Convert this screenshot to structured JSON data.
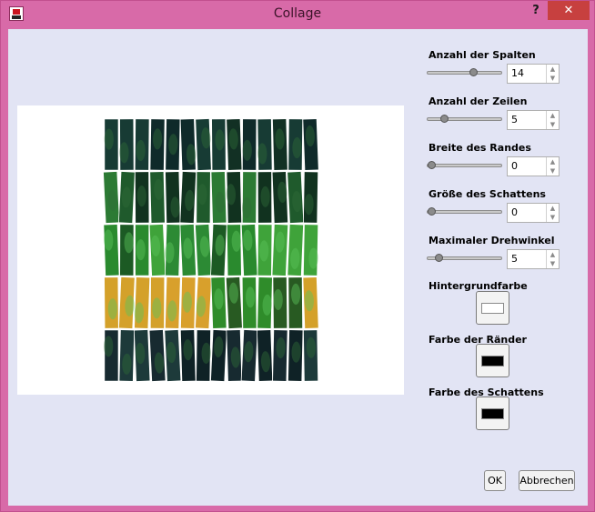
{
  "window": {
    "title": "Collage",
    "help_label": "?",
    "close_label": "✕"
  },
  "controls": {
    "columns": {
      "label": "Anzahl der Spalten",
      "value": "14",
      "slider_fraction": 0.62
    },
    "rows": {
      "label": "Anzahl der Zeilen",
      "value": "5",
      "slider_fraction": 0.19
    },
    "border_width": {
      "label": "Breite des Randes",
      "value": "0",
      "slider_fraction": 0.0
    },
    "shadow_size": {
      "label": "Größe des Schattens",
      "value": "0",
      "slider_fraction": 0.0
    },
    "max_rotation": {
      "label": "Maximaler Drehwinkel",
      "value": "5",
      "slider_fraction": 0.11
    }
  },
  "colors": {
    "background": {
      "label": "Hintergrundfarbe",
      "swatch": "#ffffff"
    },
    "border": {
      "label": "Farbe der Ränder",
      "swatch": "#000000"
    },
    "shadow": {
      "label": "Farbe des Schattens",
      "swatch": "#000000"
    }
  },
  "buttons": {
    "ok": "OK",
    "cancel": "Abbrechen"
  },
  "preview": {
    "grid_columns": 14,
    "grid_rows": 5
  },
  "icons": {
    "app": "collage-app-icon",
    "spin_up": "triangle-up-icon",
    "spin_down": "triangle-down-icon"
  }
}
